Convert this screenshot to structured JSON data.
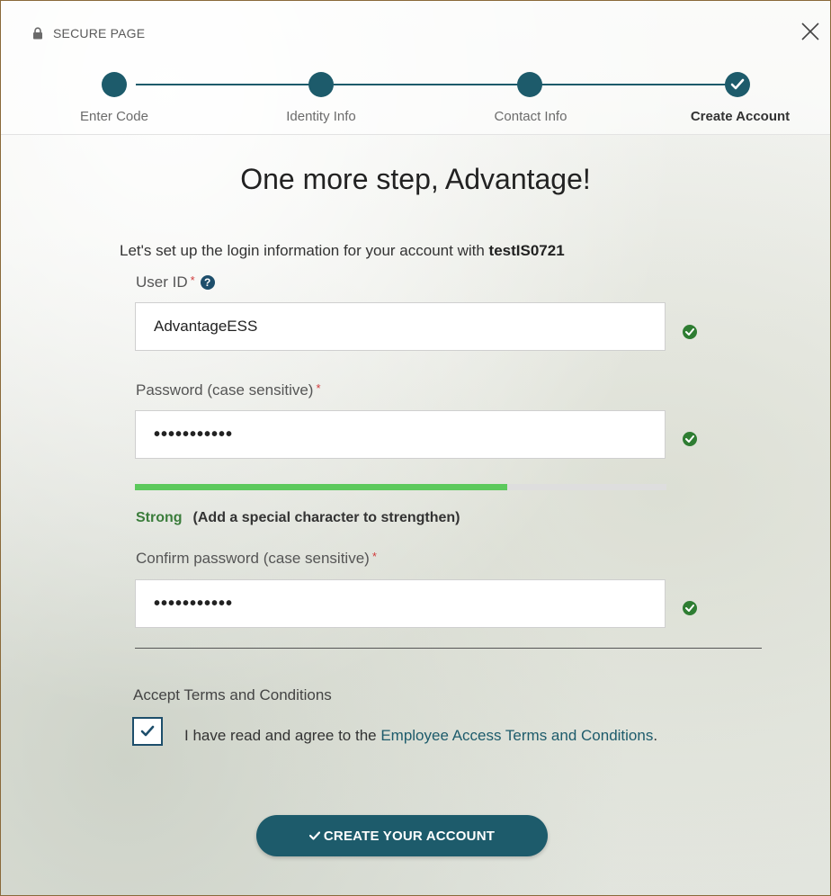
{
  "header": {
    "secure_label": "SECURE PAGE"
  },
  "steps": [
    {
      "label": "Enter Code",
      "state": "complete"
    },
    {
      "label": "Identity Info",
      "state": "complete"
    },
    {
      "label": "Contact Info",
      "state": "complete"
    },
    {
      "label": "Create Account",
      "state": "current"
    }
  ],
  "main": {
    "heading": "One more step, Advantage!",
    "intro_text": "Let's set up the login information for your account with ",
    "account_name": "testIS0721"
  },
  "form": {
    "user_id": {
      "label": "User ID",
      "required_mark": "*",
      "help_symbol": "?",
      "value": "AdvantageESS",
      "valid": true
    },
    "password": {
      "label": "Password (case sensitive)",
      "required_mark": "*",
      "value": "•••••••••••",
      "valid": true
    },
    "strength": {
      "level": 0.7,
      "word": "Strong",
      "hint": "(Add a special character to strengthen)"
    },
    "confirm_password": {
      "label": "Confirm password (case sensitive)",
      "required_mark": "*",
      "value": "•••••••••••",
      "valid": true
    }
  },
  "terms": {
    "heading": "Accept Terms and Conditions",
    "checked": true,
    "text_before": "I have read and agree to the ",
    "link_text": "Employee Access Terms and Conditions",
    "text_after": "."
  },
  "actions": {
    "create_label": "CREATE YOUR ACCOUNT"
  },
  "colors": {
    "primary": "#1d5b6b",
    "success": "#2e7d32",
    "strength_bar": "#5cc95c",
    "required": "#d03b3b"
  },
  "icons": {
    "secure": "lock-icon",
    "close": "close-icon",
    "valid": "check-circle-icon",
    "help": "question-circle-icon",
    "checkbox": "check-icon"
  }
}
